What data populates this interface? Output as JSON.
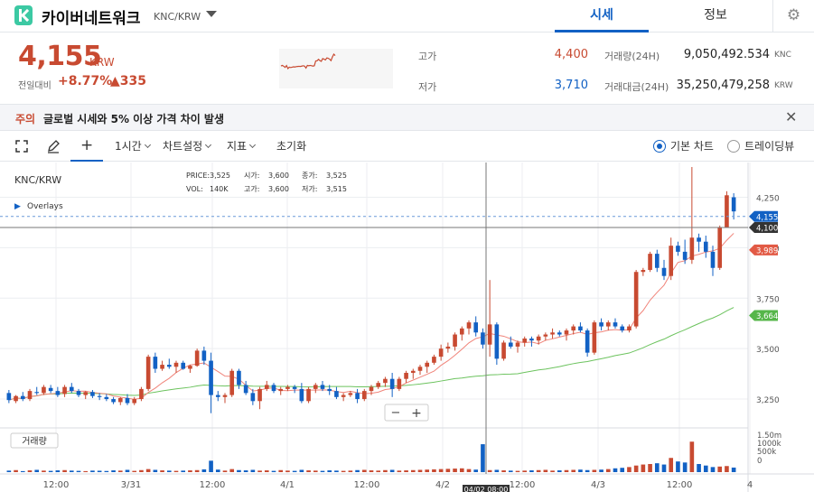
{
  "header": {
    "coin_name": "카이버네트워크",
    "coin_pair": "KNC/KRW",
    "tabs": [
      "시세",
      "정보"
    ]
  },
  "ticker": {
    "price": "4,155",
    "currency": "KRW",
    "compare_label": "전일대비",
    "change_pct": "+8.77%",
    "change_amt": "▲335",
    "high_label": "고가",
    "high": "4,400",
    "low_label": "저가",
    "low": "3,710",
    "volume_label": "거래량(24H)",
    "volume": "9,050,492.534",
    "volume_unit": "KNC",
    "value_label": "거래대금(24H)",
    "value": "35,250,479,258",
    "value_unit": "KRW"
  },
  "notice": {
    "tag": "주의",
    "text": "글로벌 시세와 5% 이상 가격 차이 발생"
  },
  "toolbar": {
    "interval": "1시간",
    "chart_settings": "차트설정",
    "indicators": "지표",
    "reset": "초기화",
    "basic_chart": "기본 차트",
    "tradingview": "트레이딩뷰"
  },
  "chart_info": {
    "symbol": "KNC/KRW",
    "overlays": "Overlays",
    "price_label": "PRICE:",
    "price": "3,525",
    "vol_label": "VOL:",
    "vol": "140K",
    "open_label": "시가:",
    "open": "3,600",
    "high_label": "고가:",
    "high": "3,600",
    "close_label": "종가:",
    "close": "3,525",
    "low_label": "저가:",
    "low": "3,515",
    "volume_panel_label": "거래량",
    "zoom_out": "−",
    "zoom_in": "+",
    "cursor_time": "04/02 08:00"
  },
  "colors": {
    "up": "#c84a31",
    "down": "#1261c4",
    "ma_short": "#f0847a",
    "ma_long": "#6cc35e"
  },
  "chart_data": {
    "type": "candlestick",
    "y_ticks": [
      "4,250",
      "4,000",
      "3,750",
      "3,500",
      "3,250"
    ],
    "y_tick_values": [
      4250,
      4000,
      3750,
      3500,
      3250
    ],
    "y_range": [
      3125,
      4400
    ],
    "x_ticks": [
      "12:00",
      "3/31",
      "12:00",
      "4/1",
      "12:00",
      "4/2",
      "12:00",
      "4/3",
      "12:00",
      "4"
    ],
    "volume_ticks": [
      "1.50m",
      "1000k",
      "500k",
      "0"
    ],
    "volume_tick_values": [
      1500,
      1000,
      500,
      0
    ],
    "price_tags": [
      {
        "label": "4,155",
        "value": 4155,
        "color": "#1261c4"
      },
      {
        "label": "4,100",
        "value": 4100,
        "color": "#333333"
      },
      {
        "label": "3,989",
        "value": 3989,
        "color": "#e25a45"
      },
      {
        "label": "3,664",
        "value": 3664,
        "color": "#56b64a"
      }
    ],
    "ohlc": [
      [
        3280,
        3295,
        3230,
        3245
      ],
      [
        3240,
        3270,
        3230,
        3265
      ],
      [
        3265,
        3285,
        3240,
        3250
      ],
      [
        3250,
        3300,
        3240,
        3290
      ],
      [
        3285,
        3310,
        3270,
        3280
      ],
      [
        3280,
        3320,
        3270,
        3310
      ],
      [
        3305,
        3320,
        3280,
        3290
      ],
      [
        3290,
        3310,
        3260,
        3270
      ],
      [
        3275,
        3320,
        3260,
        3310
      ],
      [
        3310,
        3330,
        3280,
        3290
      ],
      [
        3290,
        3300,
        3260,
        3270
      ],
      [
        3270,
        3290,
        3250,
        3285
      ],
      [
        3285,
        3295,
        3255,
        3265
      ],
      [
        3265,
        3280,
        3245,
        3260
      ],
      [
        3260,
        3275,
        3240,
        3250
      ],
      [
        3250,
        3260,
        3225,
        3235
      ],
      [
        3235,
        3260,
        3220,
        3255
      ],
      [
        3255,
        3275,
        3220,
        3230
      ],
      [
        3230,
        3260,
        3220,
        3250
      ],
      [
        3250,
        3310,
        3240,
        3300
      ],
      [
        3300,
        3470,
        3290,
        3460
      ],
      [
        3460,
        3480,
        3380,
        3400
      ],
      [
        3400,
        3440,
        3390,
        3420
      ],
      [
        3420,
        3450,
        3400,
        3410
      ],
      [
        3410,
        3440,
        3380,
        3430
      ],
      [
        3430,
        3440,
        3395,
        3400
      ],
      [
        3400,
        3420,
        3380,
        3415
      ],
      [
        3415,
        3500,
        3410,
        3490
      ],
      [
        3490,
        3510,
        3420,
        3440
      ],
      [
        3440,
        3480,
        3180,
        3270
      ],
      [
        3270,
        3290,
        3240,
        3260
      ],
      [
        3260,
        3280,
        3230,
        3270
      ],
      [
        3270,
        3400,
        3260,
        3390
      ],
      [
        3390,
        3400,
        3300,
        3320
      ],
      [
        3320,
        3340,
        3270,
        3280
      ],
      [
        3280,
        3300,
        3220,
        3240
      ],
      [
        3240,
        3310,
        3200,
        3300
      ],
      [
        3300,
        3340,
        3290,
        3320
      ],
      [
        3320,
        3330,
        3280,
        3290
      ],
      [
        3290,
        3310,
        3270,
        3300
      ],
      [
        3300,
        3320,
        3290,
        3310
      ],
      [
        3310,
        3320,
        3280,
        3300
      ],
      [
        3300,
        3330,
        3230,
        3240
      ],
      [
        3240,
        3310,
        3230,
        3300
      ],
      [
        3300,
        3330,
        3280,
        3320
      ],
      [
        3320,
        3340,
        3290,
        3300
      ],
      [
        3300,
        3320,
        3270,
        3290
      ],
      [
        3290,
        3310,
        3250,
        3260
      ],
      [
        3260,
        3280,
        3240,
        3270
      ],
      [
        3270,
        3290,
        3260,
        3280
      ],
      [
        3280,
        3300,
        3230,
        3250
      ],
      [
        3250,
        3300,
        3240,
        3290
      ],
      [
        3290,
        3320,
        3270,
        3310
      ],
      [
        3310,
        3340,
        3300,
        3330
      ],
      [
        3330,
        3360,
        3310,
        3350
      ],
      [
        3350,
        3380,
        3260,
        3300
      ],
      [
        3300,
        3360,
        3290,
        3350
      ],
      [
        3350,
        3390,
        3330,
        3380
      ],
      [
        3380,
        3400,
        3350,
        3390
      ],
      [
        3390,
        3420,
        3370,
        3410
      ],
      [
        3410,
        3440,
        3380,
        3430
      ],
      [
        3430,
        3470,
        3420,
        3460
      ],
      [
        3460,
        3520,
        3440,
        3500
      ],
      [
        3500,
        3530,
        3480,
        3510
      ],
      [
        3510,
        3580,
        3490,
        3570
      ],
      [
        3570,
        3610,
        3540,
        3600
      ],
      [
        3600,
        3640,
        3570,
        3630
      ],
      [
        3630,
        3660,
        3560,
        3580
      ],
      [
        3580,
        3600,
        3500,
        3520
      ],
      [
        3520,
        3840,
        3460,
        3620
      ],
      [
        3620,
        3630,
        3420,
        3450
      ],
      [
        3450,
        3540,
        3440,
        3530
      ],
      [
        3530,
        3560,
        3500,
        3510
      ],
      [
        3510,
        3540,
        3480,
        3530
      ],
      [
        3530,
        3560,
        3510,
        3550
      ],
      [
        3550,
        3560,
        3510,
        3540
      ],
      [
        3540,
        3570,
        3520,
        3560
      ],
      [
        3560,
        3580,
        3540,
        3570
      ],
      [
        3570,
        3600,
        3550,
        3580
      ],
      [
        3580,
        3590,
        3560,
        3570
      ],
      [
        3570,
        3600,
        3540,
        3590
      ],
      [
        3590,
        3620,
        3570,
        3610
      ],
      [
        3610,
        3630,
        3580,
        3590
      ],
      [
        3590,
        3600,
        3460,
        3480
      ],
      [
        3480,
        3640,
        3470,
        3630
      ],
      [
        3630,
        3650,
        3590,
        3610
      ],
      [
        3610,
        3640,
        3590,
        3630
      ],
      [
        3630,
        3650,
        3600,
        3610
      ],
      [
        3610,
        3620,
        3580,
        3590
      ],
      [
        3590,
        3620,
        3580,
        3610
      ],
      [
        3610,
        3890,
        3600,
        3880
      ],
      [
        3880,
        3900,
        3860,
        3890
      ],
      [
        3890,
        3980,
        3880,
        3970
      ],
      [
        3970,
        3990,
        3880,
        3900
      ],
      [
        3900,
        3940,
        3840,
        3860
      ],
      [
        3860,
        4050,
        3840,
        4010
      ],
      [
        4010,
        4030,
        3960,
        3980
      ],
      [
        3980,
        4040,
        3920,
        3940
      ],
      [
        3940,
        4400,
        3920,
        4050
      ],
      [
        4050,
        4070,
        3980,
        4030
      ],
      [
        4030,
        4060,
        3950,
        3980
      ],
      [
        3980,
        4010,
        3860,
        3900
      ],
      [
        3900,
        4110,
        3890,
        4100
      ],
      [
        4100,
        4280,
        4100,
        4260
      ],
      [
        4250,
        4270,
        4140,
        4180
      ]
    ],
    "volumes": [
      60,
      80,
      40,
      70,
      90,
      60,
      50,
      70,
      80,
      60,
      50,
      40,
      60,
      55,
      45,
      70,
      60,
      90,
      50,
      80,
      120,
      90,
      70,
      60,
      50,
      60,
      70,
      80,
      110,
      450,
      100,
      60,
      120,
      80,
      70,
      90,
      60,
      70,
      50,
      80,
      60,
      50,
      90,
      70,
      60,
      50,
      70,
      60,
      50,
      60,
      80,
      90,
      70,
      60,
      80,
      90,
      60,
      70,
      80,
      90,
      100,
      110,
      120,
      130,
      140,
      150,
      120,
      100,
      1100,
      80,
      90,
      70,
      60,
      50,
      60,
      70,
      80,
      90,
      60,
      70,
      80,
      90,
      100,
      80,
      90,
      100,
      120,
      150,
      170,
      200,
      260,
      300,
      320,
      350,
      300,
      560,
      420,
      380,
      1200,
      320,
      260,
      200,
      220,
      240,
      180,
      150
    ]
  }
}
